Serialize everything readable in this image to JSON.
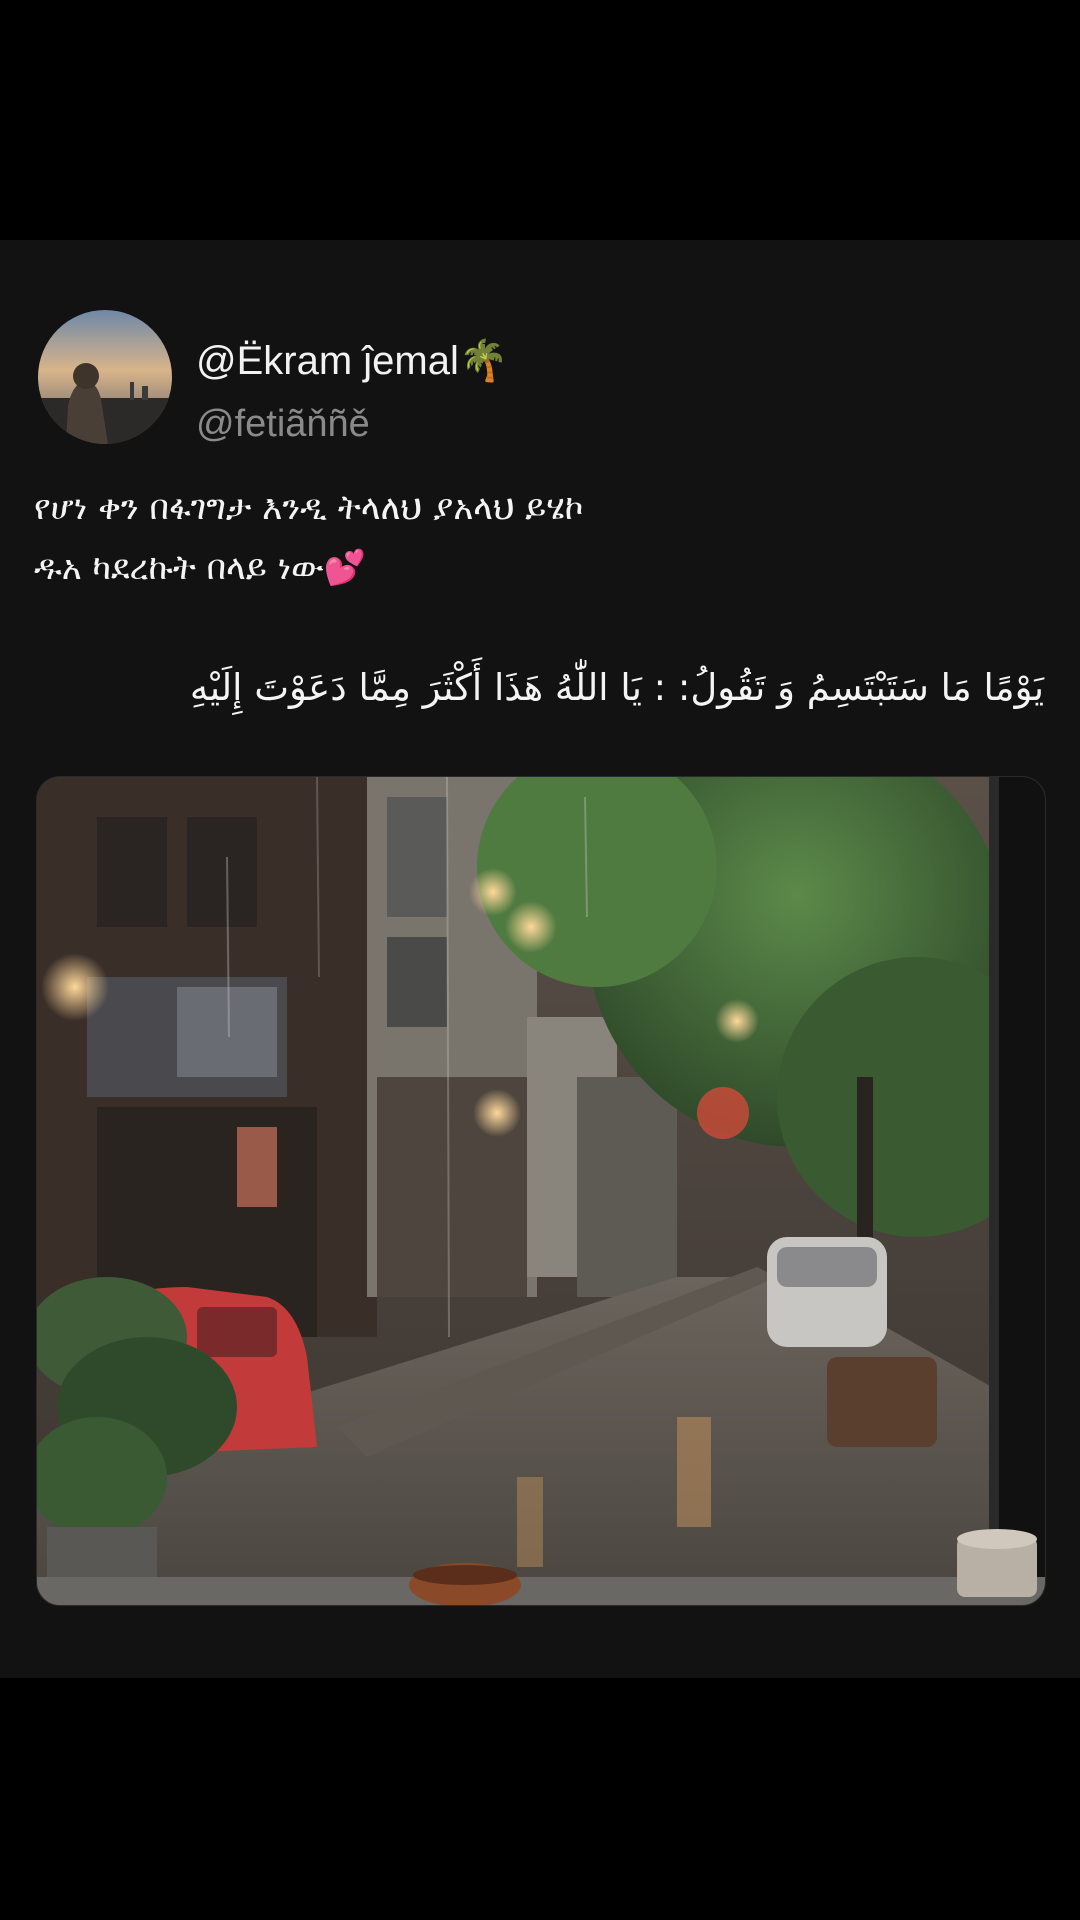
{
  "post": {
    "display_name": "@Ëkram ĵemal🌴",
    "handle": "@fetiãňñě",
    "text_line_1": "የሆነ ቀን በፋገግታ እንዲ ትላለህ ያአላህ ይሄኮ",
    "text_line_2": "ዱአ ካደረኩት በላይ ነው💕",
    "text_line_3": "يَوْمًا مَا سَتَبْتَسِمُ وَ تَقُولُ: : يَا اللّٰهُ هَذَا أَكْثَرَ مِمَّا دَعَوْتَ إِلَيْهِ"
  },
  "colors": {
    "background": "#000000",
    "card": "#121212",
    "text": "#f4f4f4",
    "muted": "#8a8a8a"
  },
  "media": {
    "type": "image",
    "subject": "rainy street through window"
  }
}
